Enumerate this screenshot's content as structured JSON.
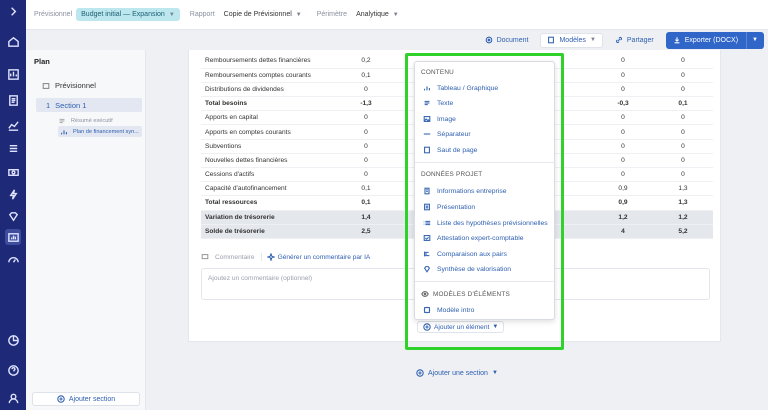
{
  "topbar": {
    "previsionnel_label": "Prévisionnel",
    "previsionnel_value": "Budget initial — Expansion",
    "rapport_label": "Rapport",
    "rapport_value": "Copie de Prévisionnel",
    "perimetre_label": "Périmètre",
    "perimetre_value": "Analytique"
  },
  "toolbar": {
    "document": "Document",
    "modeles": "Modèles",
    "partager": "Partager",
    "exporter": "Exporter (DOCX)"
  },
  "plan": {
    "title": "Plan",
    "previsionnel": "Prévisionnel",
    "section_number": "1",
    "section_label": "Section 1",
    "sub_resume": "Résumé exécutif",
    "sub_plan": "Plan de financement syn...",
    "add_section": "Ajouter section"
  },
  "table": {
    "rows": [
      {
        "label": "Remboursements dettes financières",
        "v1": "0,2",
        "v2": "0",
        "v3": "0",
        "style": ""
      },
      {
        "label": "Remboursements comptes courants",
        "v1": "0,1",
        "v2": "0",
        "v3": "0",
        "style": ""
      },
      {
        "label": "Distributions de dividendes",
        "v1": "0",
        "v2": "0",
        "v3": "0",
        "style": ""
      },
      {
        "label": "Total besoins",
        "v1": "-1,3",
        "v2": "-0,3",
        "v3": "0,1",
        "style": "bold"
      },
      {
        "label": "Apports en capital",
        "v1": "0",
        "v2": "0",
        "v3": "0",
        "style": ""
      },
      {
        "label": "Apports en comptes courants",
        "v1": "0",
        "v2": "0",
        "v3": "0",
        "style": ""
      },
      {
        "label": "Subventions",
        "v1": "0",
        "v2": "0",
        "v3": "0",
        "style": ""
      },
      {
        "label": "Nouvelles dettes financières",
        "v1": "0",
        "v2": "0",
        "v3": "0",
        "style": ""
      },
      {
        "label": "Cessions d'actifs",
        "v1": "0",
        "v2": "0",
        "v3": "0",
        "style": ""
      },
      {
        "label": "Capacité d'autofinancement",
        "v1": "0,1",
        "v2": "0,9",
        "v3": "1,3",
        "style": ""
      },
      {
        "label": "Total ressources",
        "v1": "0,1",
        "v2": "0,9",
        "v3": "1,3",
        "style": "bold"
      },
      {
        "label": "Variation de trésorerie",
        "v1": "1,4",
        "v2": "1,2",
        "v3": "1,2",
        "style": "shade"
      },
      {
        "label": "Solde de trésorerie",
        "v1": "2,5",
        "v2": "4",
        "v3": "5,2",
        "style": "shade"
      }
    ]
  },
  "comment": {
    "label": "Commentaire",
    "generate": "Générer un commentaire par IA",
    "placeholder": "Ajoutez un commentaire (optionnel)"
  },
  "add_element": "Ajouter un élément",
  "add_section": "Ajouter une section",
  "menu": {
    "contenu_title": "CONTENU",
    "contenu": [
      "Tableau / Graphique",
      "Texte",
      "Image",
      "Séparateur",
      "Saut de page"
    ],
    "donnees_title": "DONNÉES PROJET",
    "donnees": [
      "Informations entreprise",
      "Présentation",
      "Liste des hypothèses prévisionnelles",
      "Attestation expert-comptable",
      "Comparaison aux pairs",
      "Synthèse de valorisation"
    ],
    "modeles_title": "MODÈLES D'ÉLÉMENTS",
    "modeles": [
      "Modèle intro"
    ]
  }
}
